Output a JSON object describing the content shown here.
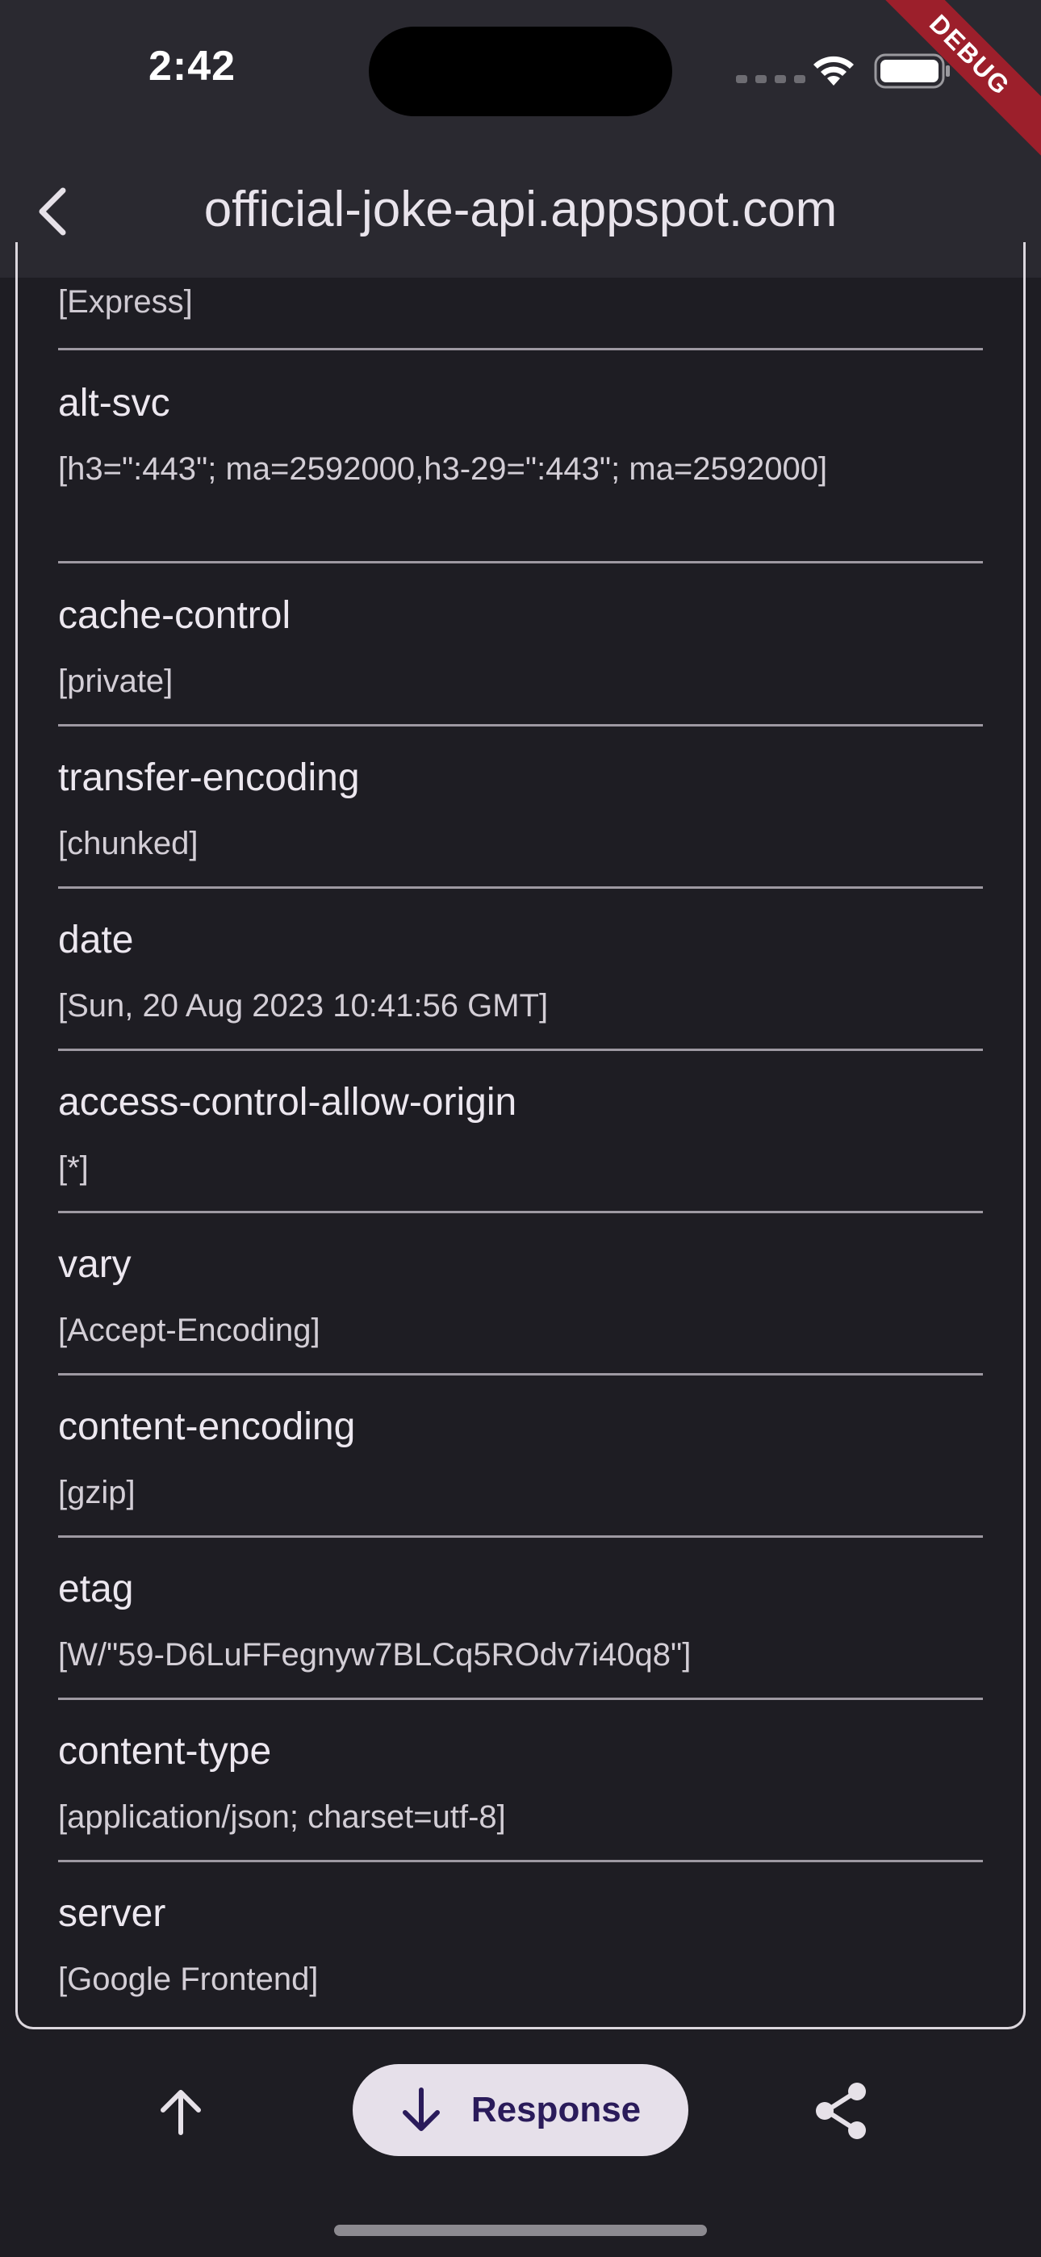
{
  "status_bar": {
    "time": "2:42"
  },
  "debug_banner": "DEBUG",
  "app_bar": {
    "title": "official-joke-api.appspot.com"
  },
  "headers": [
    {
      "key": "",
      "value": "[Express]"
    },
    {
      "key": "alt-svc",
      "value": "[h3=\":443\"; ma=2592000,h3-29=\":443\"; ma=2592000]"
    },
    {
      "key": "cache-control",
      "value": "[private]"
    },
    {
      "key": "transfer-encoding",
      "value": "[chunked]"
    },
    {
      "key": "date",
      "value": "[Sun, 20 Aug 2023 10:41:56 GMT]"
    },
    {
      "key": "access-control-allow-origin",
      "value": "[*]"
    },
    {
      "key": "vary",
      "value": "[Accept-Encoding]"
    },
    {
      "key": "content-encoding",
      "value": "[gzip]"
    },
    {
      "key": "etag",
      "value": "[W/\"59-D6LuFFegnyw7BLCq5ROdv7i40q8\"]"
    },
    {
      "key": "content-type",
      "value": "[application/json; charset=utf-8]"
    },
    {
      "key": "server",
      "value": "[Google Frontend]"
    }
  ],
  "bottom_bar": {
    "response_label": "Response"
  },
  "icons": {
    "back": "chevron-left-icon",
    "scroll_up": "arrow-up-icon",
    "response": "arrow-down-icon",
    "share": "share-icon"
  }
}
